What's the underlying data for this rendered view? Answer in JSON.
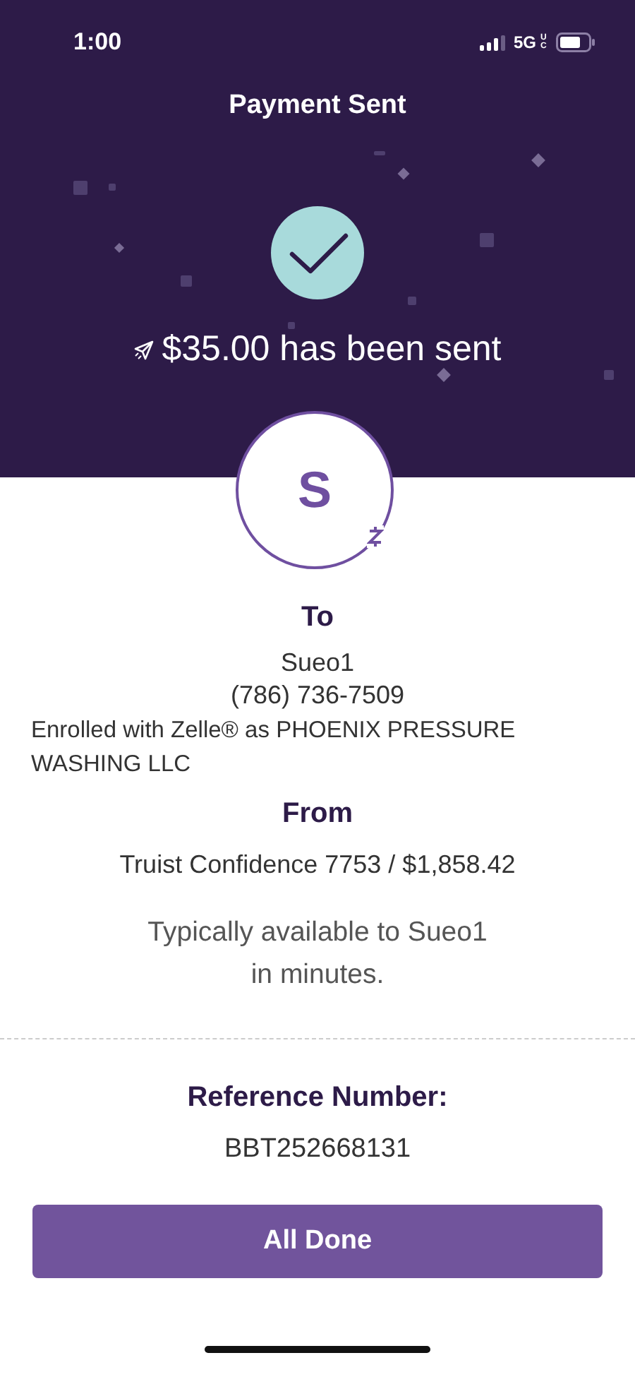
{
  "status_bar": {
    "time": "1:00",
    "network": "5G",
    "network_badge": "UC"
  },
  "header": {
    "title": "Payment Sent",
    "amount_message": "$35.00 has been sent"
  },
  "recipient": {
    "avatar_letter": "S",
    "heading": "To",
    "name": "Sueo1",
    "phone": "(786) 736-7509",
    "enrolled": "Enrolled with Zelle® as PHOENIX PRESSURE WASHING LLC"
  },
  "sender": {
    "heading": "From",
    "account": "Truist Confidence 7753 / $1,858.42"
  },
  "availability": "Typically available to Sueo1 in minutes.",
  "reference": {
    "label": "Reference Number:",
    "value": "BBT252668131"
  },
  "buttons": [
    "All Done"
  ]
}
